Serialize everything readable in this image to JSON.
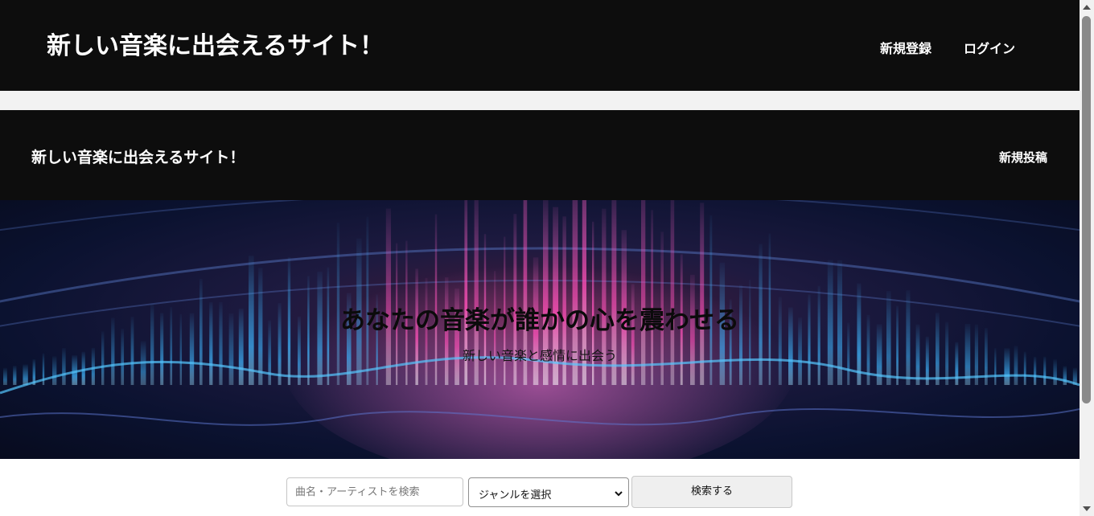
{
  "header": {
    "site_title": "新しい音楽に出会えるサイト！",
    "nav": [
      {
        "label": "新規登録"
      },
      {
        "label": "ログイン"
      }
    ]
  },
  "sub_header": {
    "site_title": "新しい音楽に出会えるサイト！",
    "new_post_label": "新規投稿"
  },
  "hero": {
    "title": "あなたの音楽が誰かの心を震わせる",
    "subtitle": "新しい音楽と感情に出会う"
  },
  "search": {
    "input_placeholder": "曲名・アーティストを検索",
    "input_value": "",
    "genre_selected": "ジャンルを選択",
    "button_label": "検索する"
  },
  "colors": {
    "header_bg": "#0d0d0d",
    "band_bg": "#f2f2f2",
    "hero_pink": "#ff4fb8",
    "hero_blue": "#3fb6ff"
  }
}
